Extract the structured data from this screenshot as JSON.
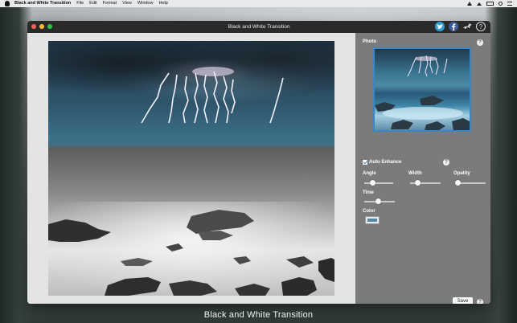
{
  "menubar": {
    "app_name": "Black and White Transition",
    "items": [
      "File",
      "Edit",
      "Format",
      "View",
      "Window",
      "Help"
    ]
  },
  "window": {
    "title": "Black and White Transition"
  },
  "toolbar_icons": [
    "twitter-icon",
    "facebook-icon",
    "dog-icon",
    "help-icon"
  ],
  "panel": {
    "photo_label": "Photo",
    "auto_enhance_label": "Auto Enhance",
    "auto_enhance_checked": true,
    "sliders": {
      "angle_label": "Angle",
      "width_label": "Width",
      "opacity_label": "Opatity",
      "time_label": "Time",
      "angle_level": 0.3,
      "width_level": 0.25,
      "opacity_level": 0.1,
      "time_level": 0.45
    },
    "color_label": "Color",
    "color_value": "#4f87a5",
    "save_label": "Save"
  },
  "caption": "Black and White Transition",
  "colors": {
    "accent": "#3d86c5",
    "panel_bg": "#7b7b7b",
    "titlebar_bg": "#2a2a2a"
  }
}
